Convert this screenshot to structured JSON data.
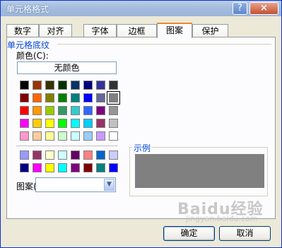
{
  "window": {
    "title": "单元格格式",
    "help_glyph": "?",
    "close_glyph": "×"
  },
  "tabs": [
    {
      "label": "数字"
    },
    {
      "label": "对齐"
    },
    {
      "label": "字体"
    },
    {
      "label": "边框"
    },
    {
      "label": "图案",
      "active": true
    },
    {
      "label": "保护"
    }
  ],
  "group": {
    "title": "单元格底纹"
  },
  "color_label": "颜色(C):",
  "no_color_button": "无颜色",
  "palette_main": [
    [
      "#000000",
      "#993300",
      "#333300",
      "#003300",
      "#003366",
      "#000080",
      "#333399",
      "#333333"
    ],
    [
      "#800000",
      "#FF6600",
      "#808000",
      "#008000",
      "#008080",
      "#0000FF",
      "#666699",
      "#808080"
    ],
    [
      "#FF0000",
      "#FF9900",
      "#99CC00",
      "#339966",
      "#33CCCC",
      "#3366FF",
      "#800080",
      "#969696"
    ],
    [
      "#FF00FF",
      "#FFCC00",
      "#FFFF00",
      "#00FF00",
      "#00FFFF",
      "#00CCFF",
      "#993366",
      "#C0C0C0"
    ],
    [
      "#FF99CC",
      "#FFCC99",
      "#FFFF99",
      "#CCFFCC",
      "#CCFFFF",
      "#99CCFF",
      "#CC99FF",
      "#FFFFFF"
    ]
  ],
  "palette_extra": [
    [
      "#9999FF",
      "#993366",
      "#FFFFCC",
      "#CCFFFF",
      "#660066",
      "#FF8080",
      "#0066CC",
      "#CCCCFF"
    ],
    [
      "#000080",
      "#FF00FF",
      "#FFFF00",
      "#00FFFF",
      "#800080",
      "#800000",
      "#008080",
      "#0000FF"
    ]
  ],
  "selected_color": "#808080",
  "pattern_label": "图案(P):",
  "pattern_value": "",
  "dropdown_glyph": "▼",
  "sample": {
    "title": "示例",
    "color": "#808080"
  },
  "buttons": {
    "ok": "确定",
    "cancel": "取消"
  },
  "watermark": {
    "text": "Baidu经验",
    "sub": "jingyan.baidu.com"
  }
}
